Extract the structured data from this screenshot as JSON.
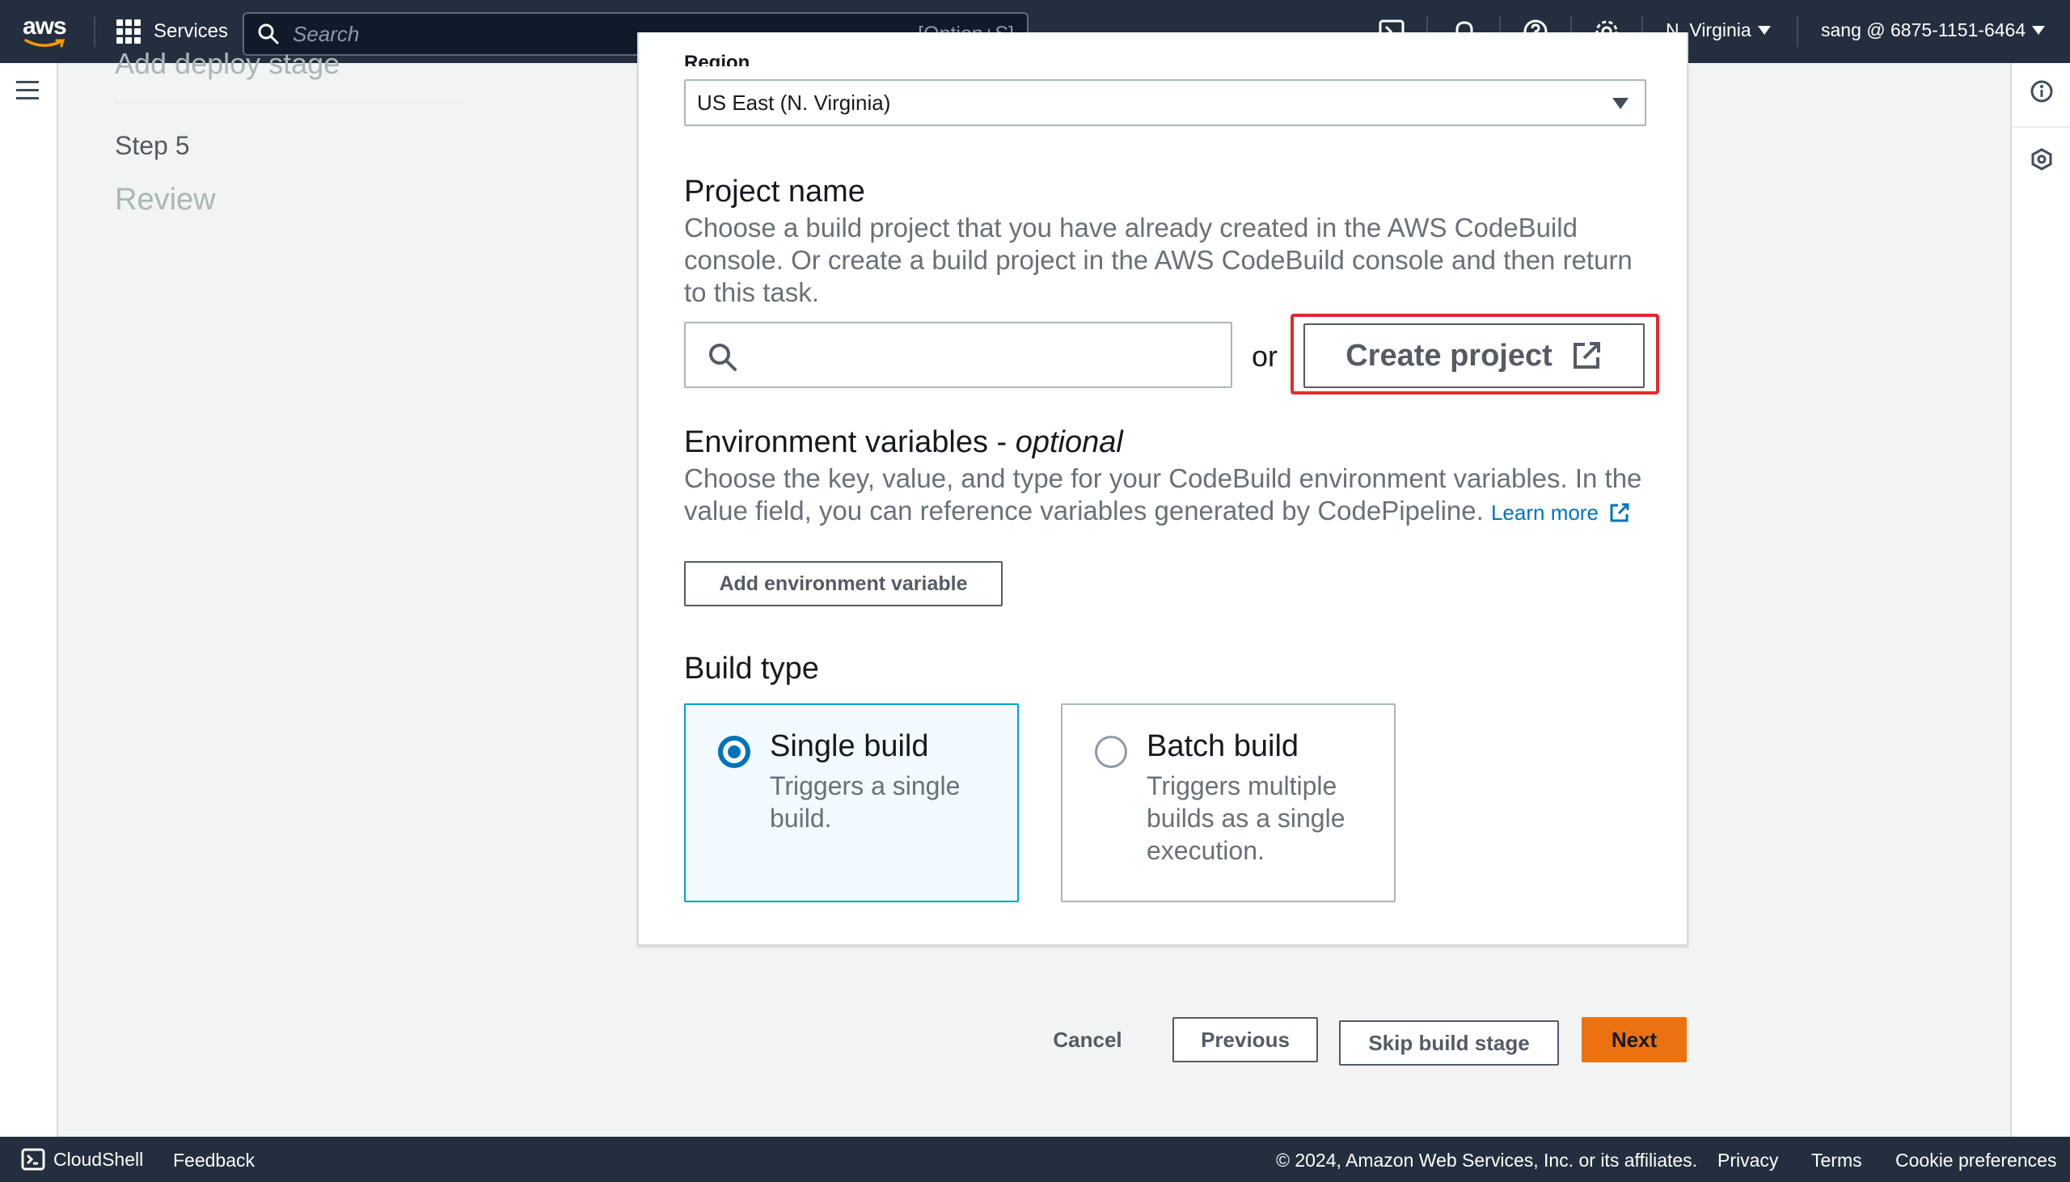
{
  "topnav": {
    "logo_text": "aws",
    "services_label": "Services",
    "search_placeholder": "Search",
    "search_shortcut": "[Option+S]",
    "region": "N. Virginia",
    "account": "sang @ 6875-1151-6464"
  },
  "sidebar": {
    "previous_step": "Add deploy stage",
    "step_number": "Step 5",
    "step_name": "Review"
  },
  "form": {
    "region_label": "Region",
    "region_value": "US East (N. Virginia)",
    "project_name": {
      "label": "Project name",
      "description": "Choose a build project that you have already created in the AWS CodeBuild console. Or create a build project in the AWS CodeBuild console and then return to this task.",
      "search_value": "",
      "or_text": "or",
      "create_label": "Create project"
    },
    "env_vars": {
      "label": "Environment variables - ",
      "optional": "optional",
      "description": "Choose the key, value, and type for your CodeBuild environment variables. In the value field, you can reference variables generated by CodePipeline.",
      "learn_more": "Learn more",
      "add_button": "Add environment variable"
    },
    "build_type": {
      "label": "Build type",
      "options": [
        {
          "title": "Single build",
          "description": "Triggers a single build.",
          "selected": true
        },
        {
          "title": "Batch build",
          "description": "Triggers multiple builds as a single execution.",
          "selected": false
        }
      ]
    }
  },
  "actions": {
    "cancel": "Cancel",
    "previous": "Previous",
    "skip": "Skip build stage",
    "next": "Next"
  },
  "footer": {
    "cloudshell": "CloudShell",
    "feedback": "Feedback",
    "copyright": "© 2024, Amazon Web Services, Inc. or its affiliates.",
    "privacy": "Privacy",
    "terms": "Terms",
    "cookies": "Cookie preferences"
  },
  "colors": {
    "nav_bg": "#232f3e",
    "primary_button": "#ec7211",
    "link": "#0073bb",
    "highlight_border": "#e02b2f",
    "selected_tile_bg": "#f1faff"
  }
}
